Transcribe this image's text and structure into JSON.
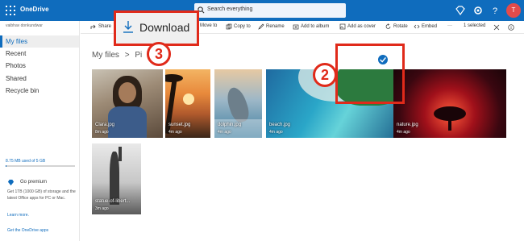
{
  "topbar": {
    "brand": "OneDrive",
    "search_text": "Search everything",
    "avatar_initial": "T"
  },
  "sidebar": {
    "user_name": "vaibhav donkundwar",
    "items": [
      {
        "label": "My files",
        "active": true
      },
      {
        "label": "Recent",
        "active": false
      },
      {
        "label": "Photos",
        "active": false
      },
      {
        "label": "Shared",
        "active": false
      },
      {
        "label": "Recycle bin",
        "active": false
      }
    ],
    "storage_text": "8.75 MB used of 5 GB",
    "storage_fraction": 0.002,
    "premium_title": "Go premium",
    "premium_desc": "Get 1TB (1000 GB) of storage and the latest Office apps for PC or Mac.",
    "premium_link": "Learn more.",
    "apps_link": "Get the OneDrive apps"
  },
  "commands": {
    "share": "Share",
    "move_to": "Move to",
    "copy_to": "Copy to",
    "rename": "Rename",
    "add_to_album": "Add to album",
    "add_as_cover": "Add as cover",
    "rotate": "Rotate",
    "embed": "Embed",
    "more": "···",
    "selected": "1 selected"
  },
  "breadcrumb": {
    "root": "My files",
    "separator": ">",
    "current": "Pi"
  },
  "photos": [
    {
      "name": "Clara.jpg",
      "time": "8m ago"
    },
    {
      "name": "sunset.jpg",
      "time": "4m ago"
    },
    {
      "name": "dolphin.jpg",
      "time": "4m ago"
    },
    {
      "name": "beach.jpg",
      "time": "4m ago"
    },
    {
      "name": "nature.jpg",
      "time": "4m ago"
    },
    {
      "name": "statue-of-libert...",
      "time": "3m ago"
    }
  ],
  "annotations": {
    "download_label": "Download",
    "step_selected": "2",
    "step_download": "3"
  },
  "colors": {
    "brand_blue": "#0f6cbd",
    "annotation_red": "#e02a1a"
  }
}
